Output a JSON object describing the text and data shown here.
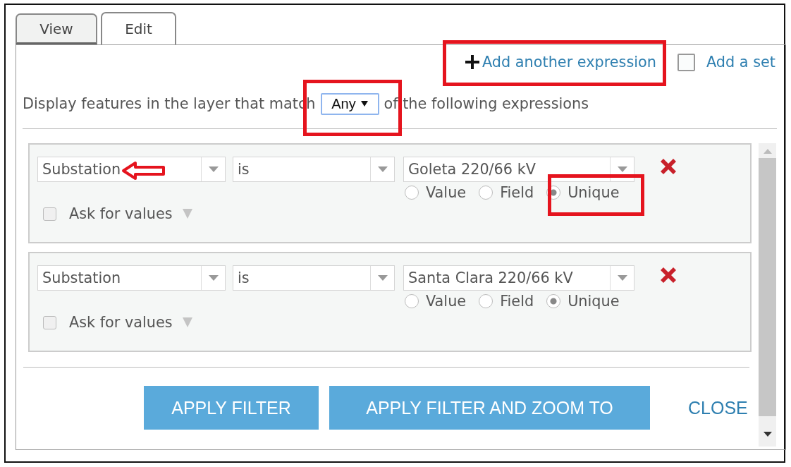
{
  "tabs": [
    {
      "label": "View",
      "selected": false
    },
    {
      "label": "Edit",
      "selected": true
    }
  ],
  "add_expression": {
    "label": "Add another expression"
  },
  "add_set": {
    "label": "Add a set",
    "checked": false
  },
  "match": {
    "before": "Display features in the layer that match",
    "value": "Any",
    "after": "of the following expressions"
  },
  "expressions": [
    {
      "field": "Substation",
      "operator": "is",
      "value": "Goleta 220/66 kV",
      "value_types": [
        {
          "label": "Value",
          "selected": false
        },
        {
          "label": "Field",
          "selected": false
        },
        {
          "label": "Unique",
          "selected": true
        }
      ],
      "ask_for_values": {
        "label": "Ask for values",
        "checked": false
      }
    },
    {
      "field": "Substation",
      "operator": "is",
      "value": "Santa Clara 220/66 kV",
      "value_types": [
        {
          "label": "Value",
          "selected": false
        },
        {
          "label": "Field",
          "selected": false
        },
        {
          "label": "Unique",
          "selected": true
        }
      ],
      "ask_for_values": {
        "label": "Ask for values",
        "checked": false
      }
    }
  ],
  "buttons": [
    {
      "label": "APPLY FILTER"
    },
    {
      "label": "APPLY FILTER AND ZOOM TO"
    }
  ],
  "close": {
    "label": "CLOSE"
  }
}
